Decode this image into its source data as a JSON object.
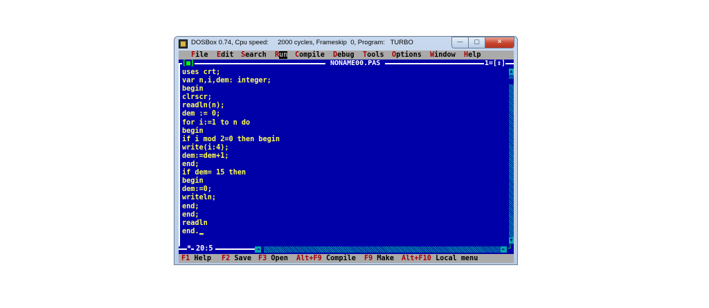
{
  "window": {
    "title": "DOSBox 0.74, Cpu speed:     2000 cycles, Frameskip  0, Program:   TURBO",
    "controls": {
      "minimize": "—",
      "maximize": "▢",
      "close": "✕"
    }
  },
  "menu": {
    "items": [
      {
        "hot": "F",
        "rest": "ile"
      },
      {
        "hot": "E",
        "rest": "dit"
      },
      {
        "hot": "S",
        "rest": "earch"
      },
      {
        "hot": "R",
        "rest": "un"
      },
      {
        "hot": "C",
        "rest": "ompile"
      },
      {
        "hot": "D",
        "rest": "ebug"
      },
      {
        "hot": "T",
        "rest": "ools"
      },
      {
        "hot": "O",
        "rest": "ptions"
      },
      {
        "hot": "W",
        "rest": "indow"
      },
      {
        "hot": "H",
        "rest": "elp"
      }
    ]
  },
  "editor": {
    "close_box": "[■]",
    "file_name": " NONAME00.PAS ",
    "window_number": "1=[↕]",
    "cursor_position": "20:5",
    "modified_marker": "*",
    "code_lines": [
      "uses crt;",
      "var n,i,dem: integer;",
      "begin",
      "clrscr;",
      "readln(n);",
      "dem := 0;",
      "for i:=1 to n do",
      "begin",
      "if i mod 2=0 then begin",
      "write(i:4);",
      "dem:=dem+1;",
      "end;",
      "if dem= 15 then",
      "begin",
      "dem:=0;",
      "writeln;",
      "end;",
      "end;",
      "readln",
      "end."
    ]
  },
  "status": {
    "items": [
      {
        "key": "F1",
        "label": "Help"
      },
      {
        "key": "F2",
        "label": "Save"
      },
      {
        "key": "F3",
        "label": "Open"
      },
      {
        "key": "Alt+F9",
        "label": "Compile"
      },
      {
        "key": "F9",
        "label": "Make"
      },
      {
        "key": "Alt+F10",
        "label": "Local menu"
      }
    ]
  },
  "colors": {
    "background": "#0000a8",
    "code_text": "#ffff54",
    "menu_bg": "#aaaaaa",
    "hotkey": "#a80000"
  }
}
